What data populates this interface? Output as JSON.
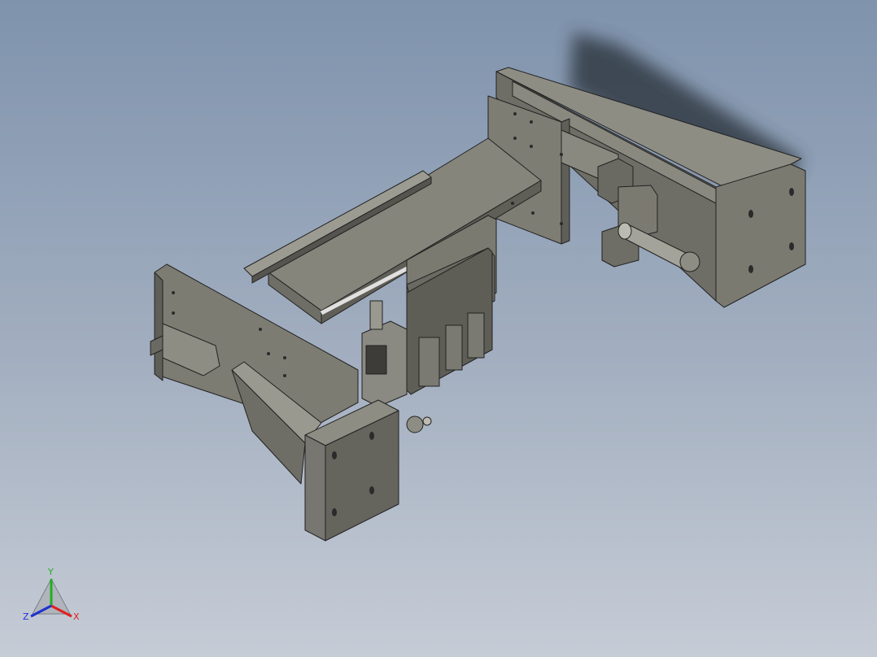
{
  "viewport": {
    "background_top": "#7f93ad",
    "background_bottom": "#c6ccd6",
    "model_colors": {
      "face_light": "#8e8d84",
      "face_mid": "#7b7a71",
      "face_dark": "#5f5e57",
      "edge": "#222222",
      "shadow": "#3c4350"
    }
  },
  "triad": {
    "x_label": "X",
    "y_label": "Y",
    "z_label": "Z",
    "x_color": "#e02020",
    "y_color": "#20b020",
    "z_color": "#2030d0"
  }
}
